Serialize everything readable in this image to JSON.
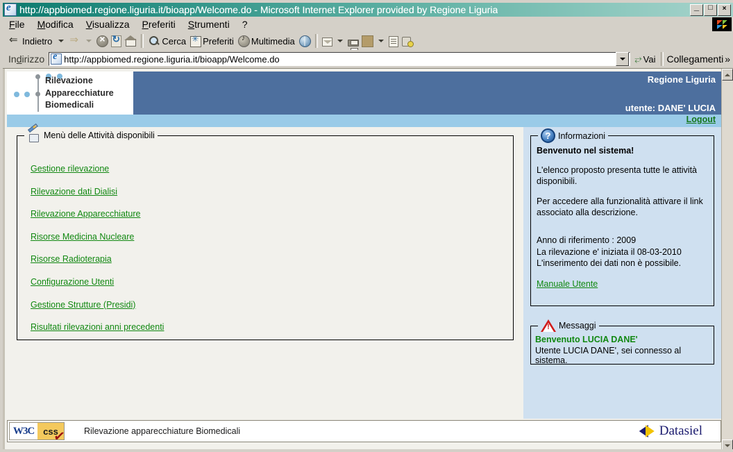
{
  "window": {
    "title": "http://appbiomed.regione.liguria.it/bioapp/Welcome.do - Microsoft Internet Explorer provided by Regione Liguria",
    "minimize_label": "_",
    "maximize_label": "□",
    "close_label": "×"
  },
  "menubar": [
    {
      "label": "File",
      "accel": "F"
    },
    {
      "label": "Modifica",
      "accel": "M"
    },
    {
      "label": "Visualizza",
      "accel": "V"
    },
    {
      "label": "Preferiti",
      "accel": "P"
    },
    {
      "label": "Strumenti",
      "accel": "S"
    },
    {
      "label": "?",
      "accel": ""
    }
  ],
  "toolbar": {
    "back": "Indietro",
    "search": "Cerca",
    "favorites": "Preferiti",
    "multimedia": "Multimedia"
  },
  "address": {
    "label": "Indirizzo",
    "value": "http://appbiomed.regione.liguria.it/bioapp/Welcome.do",
    "go_label": "Vai",
    "links_label": "Collegamenti",
    "chevron": "»"
  },
  "banner": {
    "logo_line1": "Rilevazione",
    "logo_line2": "Apparecchiature",
    "logo_line3": "Biomedicali",
    "region": "Regione Liguria",
    "user": "utente: DANE' LUCIA",
    "logout": "Logout"
  },
  "menu_panel": {
    "legend": "Menù delle Attività disponibili",
    "links": [
      "Gestione rilevazione",
      "Rilevazione dati Dialisi",
      "Rilevazione Apparecchiature",
      "Risorse Medicina Nucleare",
      "Risorse Radioterapia",
      "Configurazione Utenti",
      "Gestione Strutture (Presidi)",
      "Risultati rilevazioni anni precedenti"
    ]
  },
  "info_panel": {
    "legend": "Informazioni",
    "heading": "Benvenuto nel sistema!",
    "paragraph1": "L'elenco proposto presenta tutte le attività disponibili.",
    "paragraph2": "Per accedere alla funzionalità attivare il link associato alla descrizione.",
    "year_line": "Anno di riferimento : 2009",
    "start_line": "La rilevazione e' iniziata il 08-03-2010",
    "insert_line": "L'inserimento dei dati non è possibile.",
    "manual_link": "Manuale Utente"
  },
  "messages_panel": {
    "legend": "Messaggi",
    "heading": "Benvenuto LUCIA DANE'",
    "text": "Utente LUCIA DANE', sei connesso al sistema."
  },
  "footer": {
    "w3c_left": "W3C",
    "w3c_right": "css",
    "text": "Rilevazione apparecchiature Biomedicali",
    "vendor": "Datasiel"
  },
  "colors": {
    "banner_blue": "#4d6f9e",
    "strip_blue": "#9acbe8",
    "panel_blue": "#cfe0f0",
    "link_green": "#118811",
    "page_bg": "#f2f1ec",
    "chrome": "#d4d0c8"
  }
}
